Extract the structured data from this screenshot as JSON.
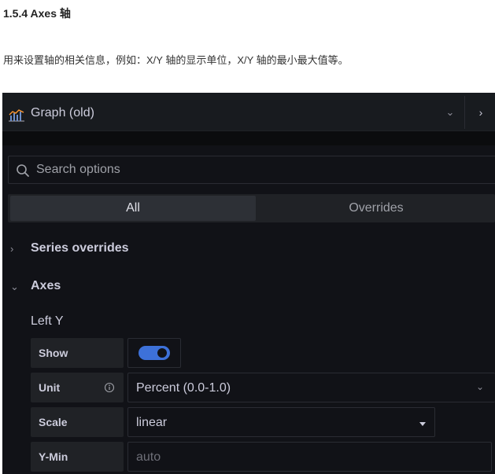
{
  "doc": {
    "title": "1.5.4 Axes 轴",
    "description": "用来设置轴的相关信息，例如：X/Y 轴的显示单位，X/Y 轴的最小最大值等。"
  },
  "panel": {
    "header": {
      "title": "Graph (old)",
      "icon": "graph-icon",
      "dropdown_icon": "chevron-down-icon",
      "next_icon": "chevron-right-icon"
    },
    "search": {
      "placeholder": "Search options",
      "icon": "search-icon"
    },
    "tabs": [
      {
        "label": "All",
        "active": true
      },
      {
        "label": "Overrides",
        "active": false
      }
    ],
    "sections": {
      "series_overrides": {
        "label": "Series overrides",
        "expanded": false
      },
      "axes": {
        "label": "Axes",
        "expanded": true
      }
    },
    "left_y": {
      "title": "Left Y",
      "show": {
        "label": "Show",
        "value": true
      },
      "unit": {
        "label": "Unit",
        "value": "Percent (0.0-1.0)",
        "icon": "info-icon"
      },
      "scale": {
        "label": "Scale",
        "value": "linear"
      },
      "y_min": {
        "label": "Y-Min",
        "placeholder": "auto"
      }
    }
  },
  "colors": {
    "panel_bg": "#111217",
    "header_bg": "#181b1f",
    "accent": "#3d71d9",
    "text": "#ccccdc"
  }
}
